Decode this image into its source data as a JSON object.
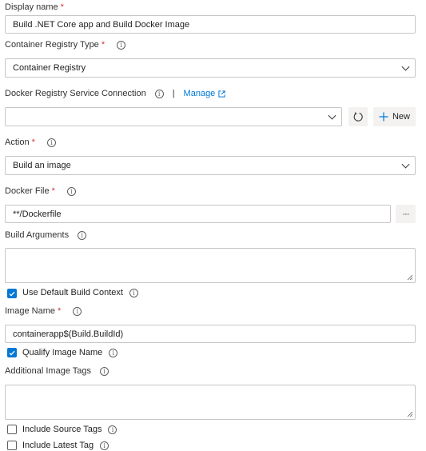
{
  "required_marker": "*",
  "info_glyph": "i",
  "display_name": {
    "label": "Display name",
    "value": "Build .NET Core app and Build Docker Image"
  },
  "container_registry_type": {
    "label": "Container Registry Type",
    "value": "Container Registry"
  },
  "docker_registry_service_connection": {
    "label": "Docker Registry Service Connection",
    "separator": "|",
    "manage_link": "Manage",
    "value": "",
    "new_button": "New"
  },
  "action": {
    "label": "Action",
    "value": "Build an image"
  },
  "docker_file": {
    "label": "Docker File",
    "value": "**/Dockerfile",
    "browse_button": "···"
  },
  "build_arguments": {
    "label": "Build Arguments",
    "value": ""
  },
  "use_default_build_context": {
    "label": "Use Default Build Context",
    "checked": true
  },
  "image_name": {
    "label": "Image Name",
    "value": "containerapp$(Build.BuildId)"
  },
  "qualify_image_name": {
    "label": "Qualify Image Name",
    "checked": true
  },
  "additional_image_tags": {
    "label": "Additional Image Tags",
    "value": ""
  },
  "include_source_tags": {
    "label": "Include Source Tags",
    "checked": false
  },
  "include_latest_tag": {
    "label": "Include Latest Tag",
    "checked": false
  },
  "colors": {
    "accent": "#0078d4",
    "required": "#d13438",
    "border": "#c8c6c4",
    "button_bg": "#f3f2f1"
  }
}
